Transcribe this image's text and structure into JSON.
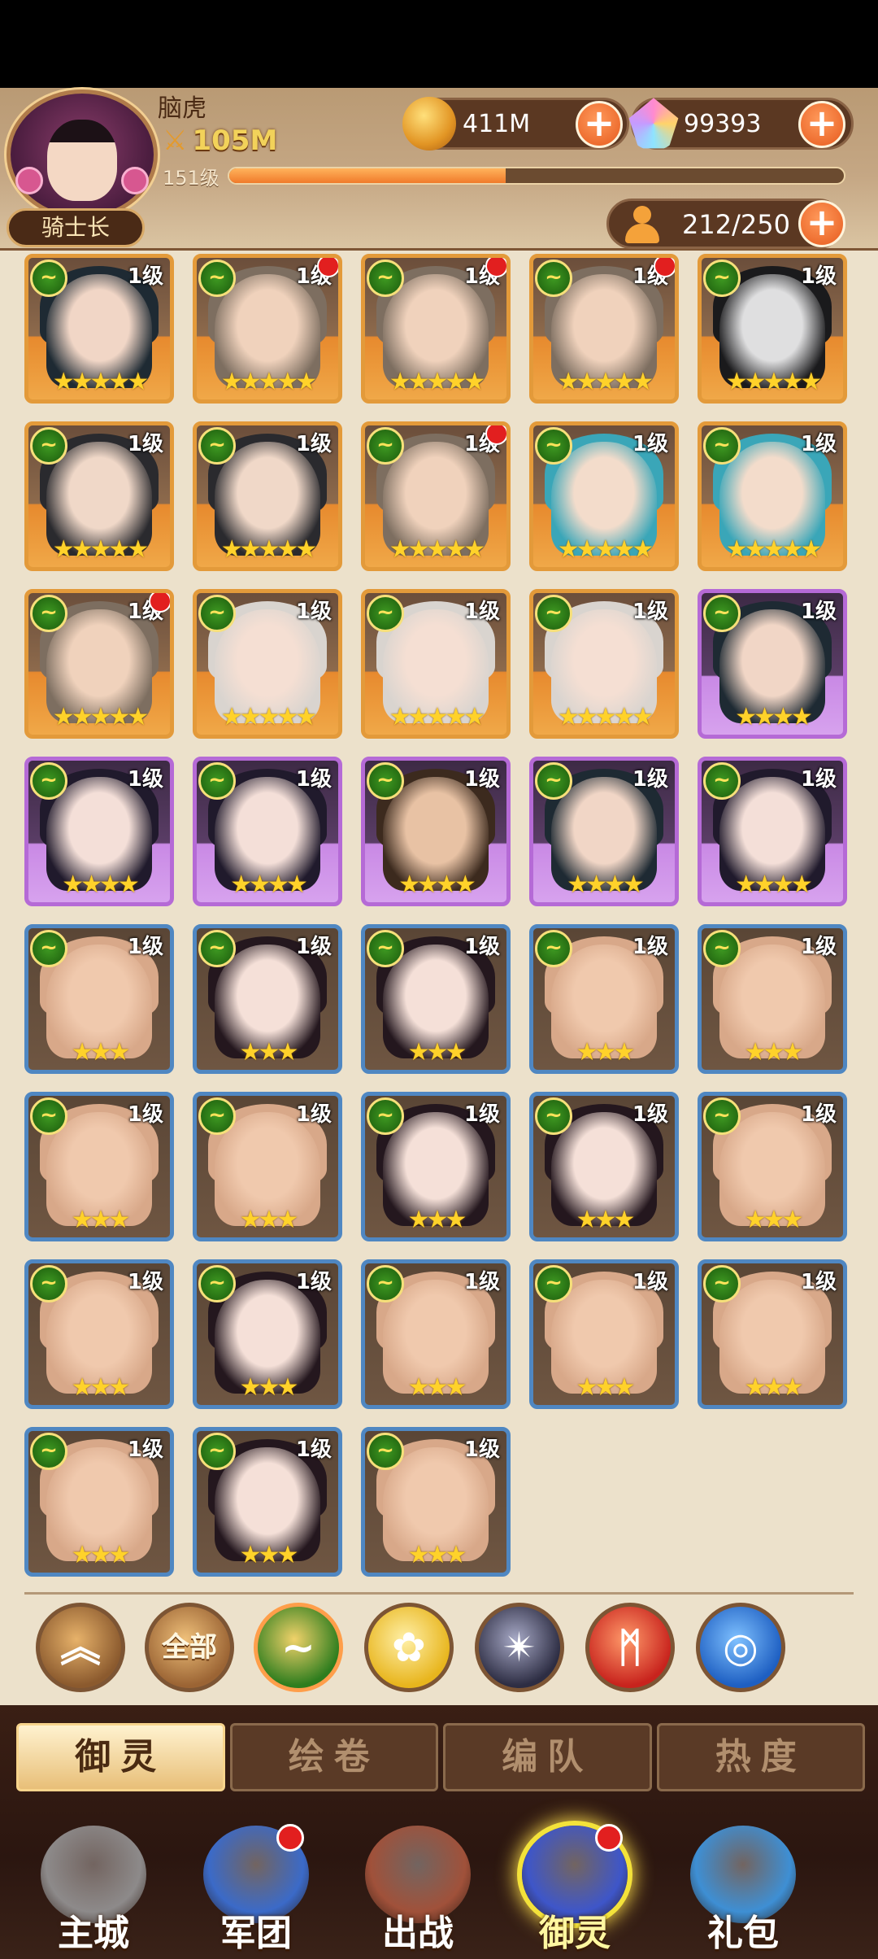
{
  "player": {
    "name": "脑虎",
    "power": "105M",
    "level": "151级",
    "exp_fraction": 0.45,
    "rank": "骑士长"
  },
  "resources": {
    "gold": "411M",
    "gems": "99393",
    "roster": "212/250"
  },
  "cards": [
    {
      "rarity": "gold",
      "level": "1级",
      "stars": 5,
      "dot": false,
      "hair": "#1e2a33",
      "skin": "#f1d6c6"
    },
    {
      "rarity": "gold",
      "level": "1级",
      "stars": 5,
      "dot": true,
      "hair": "#7d6e60",
      "skin": "#f0d2bc"
    },
    {
      "rarity": "gold",
      "level": "1级",
      "stars": 5,
      "dot": true,
      "hair": "#7d6e60",
      "skin": "#f0d2bc"
    },
    {
      "rarity": "gold",
      "level": "1级",
      "stars": 5,
      "dot": true,
      "hair": "#7d6e60",
      "skin": "#f0d2bc"
    },
    {
      "rarity": "gold",
      "level": "1级",
      "stars": 5,
      "dot": false,
      "hair": "#1a1a1c",
      "skin": "#dfdfe0"
    },
    {
      "rarity": "gold",
      "level": "1级",
      "stars": 5,
      "dot": false,
      "hair": "#2a2a2e",
      "skin": "#f0d8c8"
    },
    {
      "rarity": "gold",
      "level": "1级",
      "stars": 5,
      "dot": false,
      "hair": "#2a2a2e",
      "skin": "#f0d8c8"
    },
    {
      "rarity": "gold",
      "level": "1级",
      "stars": 5,
      "dot": true,
      "hair": "#7d6e60",
      "skin": "#f0d2bc"
    },
    {
      "rarity": "gold",
      "level": "1级",
      "stars": 5,
      "dot": false,
      "hair": "#3aa6b8",
      "skin": "#f3dccb"
    },
    {
      "rarity": "gold",
      "level": "1级",
      "stars": 5,
      "dot": false,
      "hair": "#3aa6b8",
      "skin": "#f3dccb"
    },
    {
      "rarity": "gold",
      "level": "1级",
      "stars": 5,
      "dot": true,
      "hair": "#7d6e60",
      "skin": "#f0d2bc"
    },
    {
      "rarity": "gold",
      "level": "1级",
      "stars": 5,
      "dot": false,
      "hair": "#d9d4cf",
      "skin": "#f5dfd3"
    },
    {
      "rarity": "gold",
      "level": "1级",
      "stars": 5,
      "dot": false,
      "hair": "#d9d4cf",
      "skin": "#f5dfd3"
    },
    {
      "rarity": "gold",
      "level": "1级",
      "stars": 5,
      "dot": false,
      "hair": "#d9d4cf",
      "skin": "#f5dfd3"
    },
    {
      "rarity": "purple",
      "level": "1级",
      "stars": 4,
      "dot": false,
      "hair": "#1e2a33",
      "skin": "#f1d6c6"
    },
    {
      "rarity": "purple",
      "level": "1级",
      "stars": 4,
      "dot": false,
      "hair": "#201a2c",
      "skin": "#f4dfd8"
    },
    {
      "rarity": "purple",
      "level": "1级",
      "stars": 4,
      "dot": false,
      "hair": "#201a2c",
      "skin": "#f4dfd8"
    },
    {
      "rarity": "purple",
      "level": "1级",
      "stars": 4,
      "dot": false,
      "hair": "#3c2a1e",
      "skin": "#e8c2a4"
    },
    {
      "rarity": "purple",
      "level": "1级",
      "stars": 4,
      "dot": false,
      "hair": "#1e2a33",
      "skin": "#f1d6c6"
    },
    {
      "rarity": "purple",
      "level": "1级",
      "stars": 4,
      "dot": false,
      "hair": "#201a2c",
      "skin": "#f4dfd8"
    },
    {
      "rarity": "blue",
      "level": "1级",
      "stars": 3,
      "dot": false,
      "hair": "#d8a889",
      "skin": "#f0c9ad"
    },
    {
      "rarity": "blue",
      "level": "1级",
      "stars": 3,
      "dot": false,
      "hair": "#24171e",
      "skin": "#f5e0d8"
    },
    {
      "rarity": "blue",
      "level": "1级",
      "stars": 3,
      "dot": false,
      "hair": "#24171e",
      "skin": "#f5e0d8"
    },
    {
      "rarity": "blue",
      "level": "1级",
      "stars": 3,
      "dot": false,
      "hair": "#d8a889",
      "skin": "#f0c9ad"
    },
    {
      "rarity": "blue",
      "level": "1级",
      "stars": 3,
      "dot": false,
      "hair": "#d8a889",
      "skin": "#f0c9ad"
    },
    {
      "rarity": "blue",
      "level": "1级",
      "stars": 3,
      "dot": false,
      "hair": "#d8a889",
      "skin": "#f0c9ad"
    },
    {
      "rarity": "blue",
      "level": "1级",
      "stars": 3,
      "dot": false,
      "hair": "#d8a889",
      "skin": "#f0c9ad"
    },
    {
      "rarity": "blue",
      "level": "1级",
      "stars": 3,
      "dot": false,
      "hair": "#24171e",
      "skin": "#f5e0d8"
    },
    {
      "rarity": "blue",
      "level": "1级",
      "stars": 3,
      "dot": false,
      "hair": "#24171e",
      "skin": "#f5e0d8"
    },
    {
      "rarity": "blue",
      "level": "1级",
      "stars": 3,
      "dot": false,
      "hair": "#d8a889",
      "skin": "#f0c9ad"
    },
    {
      "rarity": "blue",
      "level": "1级",
      "stars": 3,
      "dot": false,
      "hair": "#d8a889",
      "skin": "#f0c9ad"
    },
    {
      "rarity": "blue",
      "level": "1级",
      "stars": 3,
      "dot": false,
      "hair": "#24171e",
      "skin": "#f5e0d8"
    },
    {
      "rarity": "blue",
      "level": "1级",
      "stars": 3,
      "dot": false,
      "hair": "#d8a889",
      "skin": "#f0c9ad"
    },
    {
      "rarity": "blue",
      "level": "1级",
      "stars": 3,
      "dot": false,
      "hair": "#d8a889",
      "skin": "#f0c9ad"
    },
    {
      "rarity": "blue",
      "level": "1级",
      "stars": 3,
      "dot": false,
      "hair": "#d8a889",
      "skin": "#f0c9ad"
    },
    {
      "rarity": "blue",
      "level": "1级",
      "stars": 3,
      "dot": false,
      "hair": "#d8a889",
      "skin": "#f0c9ad"
    },
    {
      "rarity": "blue",
      "level": "1级",
      "stars": 3,
      "dot": false,
      "hair": "#24171e",
      "skin": "#f5e0d8"
    },
    {
      "rarity": "blue",
      "level": "1级",
      "stars": 3,
      "dot": false,
      "hair": "#d8a889",
      "skin": "#f0c9ad"
    }
  ],
  "filters": [
    {
      "name": "collapse-filter-button",
      "label": "",
      "bg": "#8b5a2e",
      "ring": "#e7b26a",
      "icon": "chevron-up-icon"
    },
    {
      "name": "all-filter-button",
      "label": "全部",
      "bg": "#9b6434",
      "ring": "#efc07a",
      "icon": ""
    },
    {
      "name": "nature-filter-button",
      "label": "",
      "bg": "#2e7d1e",
      "ring": "#f1d26a",
      "icon": "leaf-icon"
    },
    {
      "name": "light-filter-button",
      "label": "",
      "bg": "#e8b51d",
      "ring": "#fff0a8",
      "icon": "rose-icon"
    },
    {
      "name": "dark-filter-button",
      "label": "",
      "bg": "#2d2d43",
      "ring": "#a7a9c6",
      "icon": "star-sigil-icon"
    },
    {
      "name": "fire-filter-button",
      "label": "",
      "bg": "#c8231d",
      "ring": "#ff9a6a",
      "icon": "phoenix-icon"
    },
    {
      "name": "water-filter-button",
      "label": "",
      "bg": "#1e5fc2",
      "ring": "#7fc1ff",
      "icon": "wave-icon"
    }
  ],
  "tabs": [
    {
      "label": "御灵",
      "active": true
    },
    {
      "label": "绘卷",
      "active": false
    },
    {
      "label": "编队",
      "active": false
    },
    {
      "label": "热度",
      "active": false
    }
  ],
  "nav": [
    {
      "label": "主城",
      "dot": false,
      "color": "#8d8a8a",
      "active": false,
      "icon": "castle-icon"
    },
    {
      "label": "军团",
      "dot": true,
      "color": "#3b6ac8",
      "active": false,
      "icon": "fist-shield-icon"
    },
    {
      "label": "出战",
      "dot": false,
      "color": "#a0513a",
      "active": false,
      "icon": "battle-gate-icon"
    },
    {
      "label": "御灵",
      "dot": true,
      "color": "#3e56c9",
      "active": true,
      "icon": "crystal-icon"
    },
    {
      "label": "礼包",
      "dot": false,
      "color": "#3e8fd4",
      "active": false,
      "icon": "gift-shop-icon"
    }
  ]
}
